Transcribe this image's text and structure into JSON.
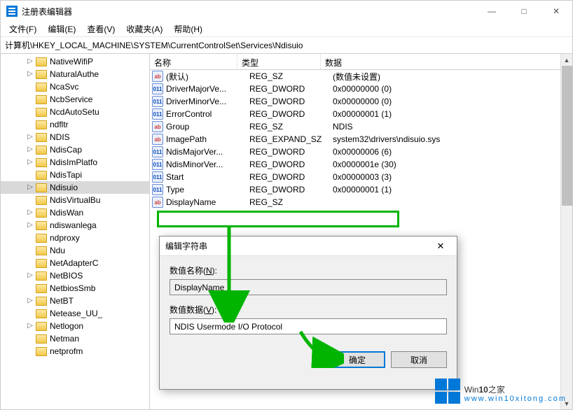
{
  "window": {
    "title": "注册表编辑器",
    "min": "—",
    "max": "□",
    "close": "✕"
  },
  "menu": {
    "file": "文件(F)",
    "edit": "编辑(E)",
    "view": "查看(V)",
    "favorites": "收藏夹(A)",
    "help": "帮助(H)"
  },
  "address": "计算机\\HKEY_LOCAL_MACHINE\\SYSTEM\\CurrentControlSet\\Services\\Ndisuio",
  "tree": [
    {
      "label": "NativeWifiP",
      "exp": "▷"
    },
    {
      "label": "NaturalAuthe",
      "exp": "▷"
    },
    {
      "label": "NcaSvc",
      "exp": ""
    },
    {
      "label": "NcbService",
      "exp": ""
    },
    {
      "label": "NcdAutoSetu",
      "exp": ""
    },
    {
      "label": "ndfltr",
      "exp": ""
    },
    {
      "label": "NDIS",
      "exp": "▷"
    },
    {
      "label": "NdisCap",
      "exp": "▷"
    },
    {
      "label": "NdisImPlatfo",
      "exp": "▷"
    },
    {
      "label": "NdisTapi",
      "exp": ""
    },
    {
      "label": "Ndisuio",
      "exp": "▷",
      "sel": true
    },
    {
      "label": "NdisVirtualBu",
      "exp": ""
    },
    {
      "label": "NdisWan",
      "exp": "▷"
    },
    {
      "label": "ndiswanlega",
      "exp": "▷"
    },
    {
      "label": "ndproxy",
      "exp": ""
    },
    {
      "label": "Ndu",
      "exp": ""
    },
    {
      "label": "NetAdapterC",
      "exp": ""
    },
    {
      "label": "NetBIOS",
      "exp": "▷"
    },
    {
      "label": "NetbiosSmb",
      "exp": ""
    },
    {
      "label": "NetBT",
      "exp": "▷"
    },
    {
      "label": "Netease_UU_",
      "exp": ""
    },
    {
      "label": "Netlogon",
      "exp": "▷"
    },
    {
      "label": "Netman",
      "exp": ""
    },
    {
      "label": "netprofm",
      "exp": ""
    }
  ],
  "list": {
    "headers": {
      "name": "名称",
      "type": "类型",
      "data": "数据"
    },
    "rows": [
      {
        "ico": "sz",
        "name": "(默认)",
        "type": "REG_SZ",
        "data": "(数值未设置)"
      },
      {
        "ico": "dw",
        "name": "DriverMajorVe...",
        "type": "REG_DWORD",
        "data": "0x00000000 (0)"
      },
      {
        "ico": "dw",
        "name": "DriverMinorVe...",
        "type": "REG_DWORD",
        "data": "0x00000000 (0)"
      },
      {
        "ico": "dw",
        "name": "ErrorControl",
        "type": "REG_DWORD",
        "data": "0x00000001 (1)"
      },
      {
        "ico": "sz",
        "name": "Group",
        "type": "REG_SZ",
        "data": "NDIS"
      },
      {
        "ico": "sz",
        "name": "ImagePath",
        "type": "REG_EXPAND_SZ",
        "data": "system32\\drivers\\ndisuio.sys"
      },
      {
        "ico": "dw",
        "name": "NdisMajorVer...",
        "type": "REG_DWORD",
        "data": "0x00000006 (6)"
      },
      {
        "ico": "dw",
        "name": "NdisMinorVer...",
        "type": "REG_DWORD",
        "data": "0x0000001e (30)"
      },
      {
        "ico": "dw",
        "name": "Start",
        "type": "REG_DWORD",
        "data": "0x00000003 (3)"
      },
      {
        "ico": "dw",
        "name": "Type",
        "type": "REG_DWORD",
        "data": "0x00000001 (1)"
      },
      {
        "ico": "sz",
        "name": "DisplayName",
        "type": "REG_SZ",
        "data": ""
      }
    ]
  },
  "dialog": {
    "title": "编辑字符串",
    "name_label": "数值名称(N):",
    "name_value": "DisplayName",
    "data_label": "数值数据(V):",
    "data_value": "NDIS Usermode I/O Protocol",
    "ok": "确定",
    "cancel": "取消",
    "close": "✕"
  },
  "watermark": {
    "brand_a": "Win",
    "brand_b": "10",
    "brand_c": "之家",
    "url": "www.win10xitong.com"
  }
}
